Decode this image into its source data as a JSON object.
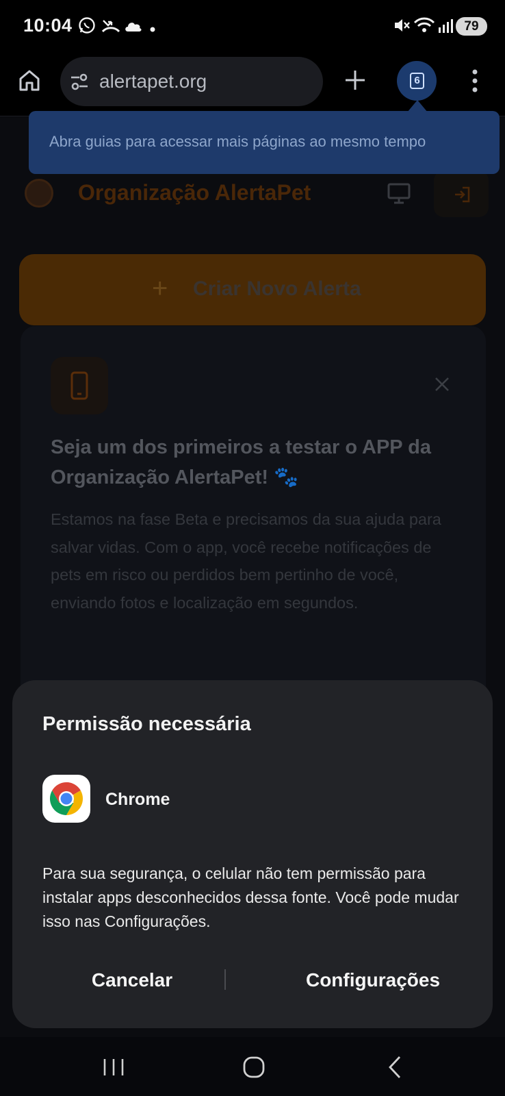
{
  "status_bar": {
    "time": "10:04",
    "battery": "79",
    "icons": [
      "whatsapp-icon",
      "missed-call-icon",
      "cloud-icon",
      "dot-icon",
      "mute-icon",
      "wifi-icon",
      "signal-icon"
    ]
  },
  "browser": {
    "url": "alertapet.org",
    "tab_count": "6",
    "tooltip": "Abra guias para acessar mais páginas ao mesmo tempo"
  },
  "page": {
    "brand_name": "Organização AlertaPet",
    "create_button": "Criar Novo Alerta",
    "promo": {
      "title": "Seja um dos primeiros a testar o APP da Organização AlertaPet! 🐾",
      "text": "Estamos na fase Beta e precisamos da sua ajuda para salvar vidas. Com o app, você recebe notificações de pets em risco ou perdidos bem pertinho de você, enviando fotos e localização em segundos."
    }
  },
  "dialog": {
    "title": "Permissão necessária",
    "app_name": "Chrome",
    "message": "Para sua segurança, o celular não tem permissão para instalar apps desconhecidos dessa fonte. Você pode mudar isso nas Configurações.",
    "cancel_label": "Cancelar",
    "settings_label": "Configurações"
  },
  "colors": {
    "accent_orange": "#f27e0d",
    "tooltip_blue": "#1e3a6b",
    "dialog_bg": "#222327"
  }
}
